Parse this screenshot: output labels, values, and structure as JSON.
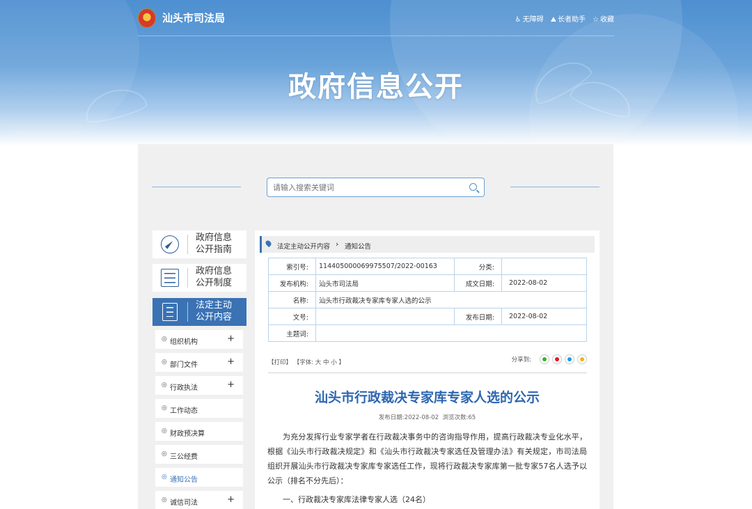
{
  "header": {
    "site_name": "汕头市司法局",
    "tools": [
      {
        "icon": "accessibility-icon",
        "label": "无障碍"
      },
      {
        "icon": "elderly-icon",
        "label": "长者助手"
      },
      {
        "icon": "star-icon",
        "label": "收藏"
      }
    ],
    "banner_title": "政府信息公开"
  },
  "search": {
    "placeholder": "请输入搜索关键词"
  },
  "sidebar": {
    "cards": [
      {
        "line1": "政府信息",
        "line2": "公开指南",
        "icon": "compass-icon"
      },
      {
        "line1": "政府信息",
        "line2": "公开制度",
        "icon": "list-icon"
      },
      {
        "line1": "法定主动",
        "line2": "公开内容",
        "icon": "document-icon"
      }
    ],
    "items": [
      {
        "label": "组织机构",
        "expand": "+"
      },
      {
        "label": "部门文件",
        "expand": "+"
      },
      {
        "label": "行政执法",
        "expand": "+"
      },
      {
        "label": "工作动态",
        "expand": ""
      },
      {
        "label": "财政预决算",
        "expand": ""
      },
      {
        "label": "三公经费",
        "expand": ""
      },
      {
        "label": "通知公告",
        "expand": ""
      },
      {
        "label": "诚信司法",
        "expand": "+"
      }
    ],
    "item_prefix": "◎"
  },
  "breadcrumb": {
    "parent": "法定主动公开内容",
    "separator": "›",
    "current": "通知公告"
  },
  "meta": {
    "index_label": "索引号:",
    "index_value": "114405000069975507/2022-00163",
    "category_label": "分类:",
    "category_value": "",
    "publisher_label": "发布机构:",
    "publisher_value": "汕头市司法局",
    "created_label": "成文日期:",
    "created_value": "2022-08-02",
    "name_label": "名称:",
    "name_value": "汕头市行政裁决专家库专家人选的公示",
    "docno_label": "文号:",
    "docno_value": "",
    "published_label": "发布日期:",
    "published_value": "2022-08-02",
    "subject_label": "主题词:",
    "subject_value": ""
  },
  "toolbar": {
    "print": "【打印】",
    "font_label": "【字体:",
    "font_large": "大",
    "font_medium": "中",
    "font_small": "小",
    "font_end": "】",
    "share_label": "分享到:"
  },
  "article": {
    "title": "汕头市行政裁决专家库专家人选的公示",
    "date_label": "发布日期:",
    "date": "2022-08-02",
    "views_label": "浏览次数:",
    "views": "65",
    "body": "为充分发挥行业专家学者在行政裁决事务中的咨询指导作用，提高行政裁决专业化水平，根据《汕头市行政裁决规定》和《汕头市行政裁决专家选任及管理办法》有关规定，市司法局组织开展汕头市行政裁决专家库专家选任工作，现将行政裁决专家库第一批专家57名人选予以公示（排名不分先后）：",
    "section1": "一、行政裁决专家库法律专家人选（24名）"
  }
}
